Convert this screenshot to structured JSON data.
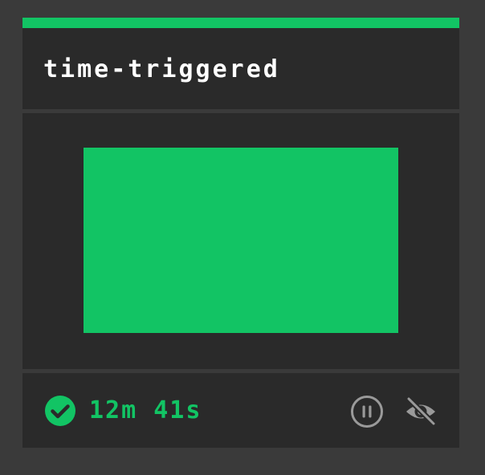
{
  "card": {
    "title": "time-triggered",
    "status_icon": "check-circle-icon",
    "elapsed": "12m 41s",
    "actions": [
      {
        "icon": "pause-icon"
      },
      {
        "icon": "eye-off-icon"
      }
    ]
  },
  "colors": {
    "accent": "#12c464",
    "page_background": "#3a3a3a",
    "card_background": "#2a2a2a",
    "title_text": "#ffffff",
    "icon_muted": "#9a9a9a"
  }
}
